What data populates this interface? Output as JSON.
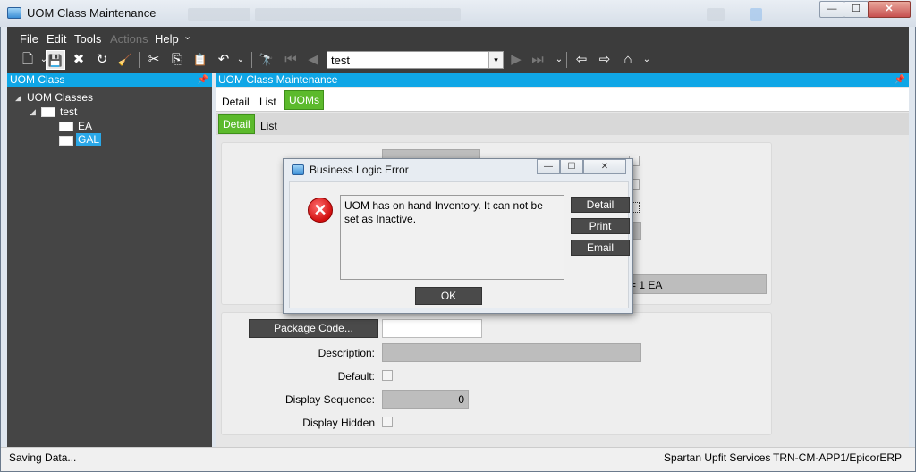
{
  "window": {
    "title": "UOM Class Maintenance",
    "min_glyph": "—",
    "max_glyph": "☐",
    "close_glyph": "✕"
  },
  "menu": {
    "items": [
      "File",
      "Edit",
      "Tools",
      "Actions",
      "Help"
    ],
    "help_caret": "⌄"
  },
  "toolbar": {
    "search_value": "test",
    "search_dropdown_glyph": "▾",
    "glyphs": {
      "new": "🗋",
      "save": "💾",
      "delete": "✖",
      "refresh": "↻",
      "clear": "🧹",
      "cut": "✂",
      "copy": "⎘",
      "paste": "📋",
      "undo": "↶",
      "search": "🔭",
      "first": "⏮",
      "prev": "◀",
      "next": "▶",
      "last": "⏭",
      "back": "⇦",
      "forward": "⇨",
      "home": "⌂",
      "caret": "⌄"
    }
  },
  "left_panel": {
    "title": "UOM Class",
    "pin_glyph": "📌",
    "tree": {
      "expand_glyph": "◢",
      "root": "UOM Classes",
      "child": "test",
      "leaves": [
        "EA",
        "GAL"
      ]
    }
  },
  "right_panel": {
    "title": "UOM Class Maintenance",
    "pin_glyph": "📌",
    "tabs_top": [
      "Detail",
      "List",
      "UOMs"
    ],
    "tabs_sub": [
      "Detail",
      "List"
    ],
    "conversion_text": "= 1 EA",
    "package_code_button": "Package Code...",
    "labels": {
      "description": "Description:",
      "default": "Default:",
      "display_sequence": "Display Sequence:",
      "display_hidden": "Display Hidden"
    },
    "display_sequence_value": "0"
  },
  "status": {
    "left": "Saving Data...",
    "company": "Spartan Upfit Services",
    "server": "TRN-CM-APP1/EpicorERP"
  },
  "dialog": {
    "title": "Business Logic Error",
    "min_glyph": "—",
    "max_glyph": "☐",
    "close_glyph": "✕",
    "error_glyph": "✕",
    "message": "UOM has on hand Inventory. It can not be set as Inactive.",
    "buttons": {
      "detail": "Detail",
      "print": "Print",
      "email": "Email",
      "ok": "OK"
    }
  }
}
